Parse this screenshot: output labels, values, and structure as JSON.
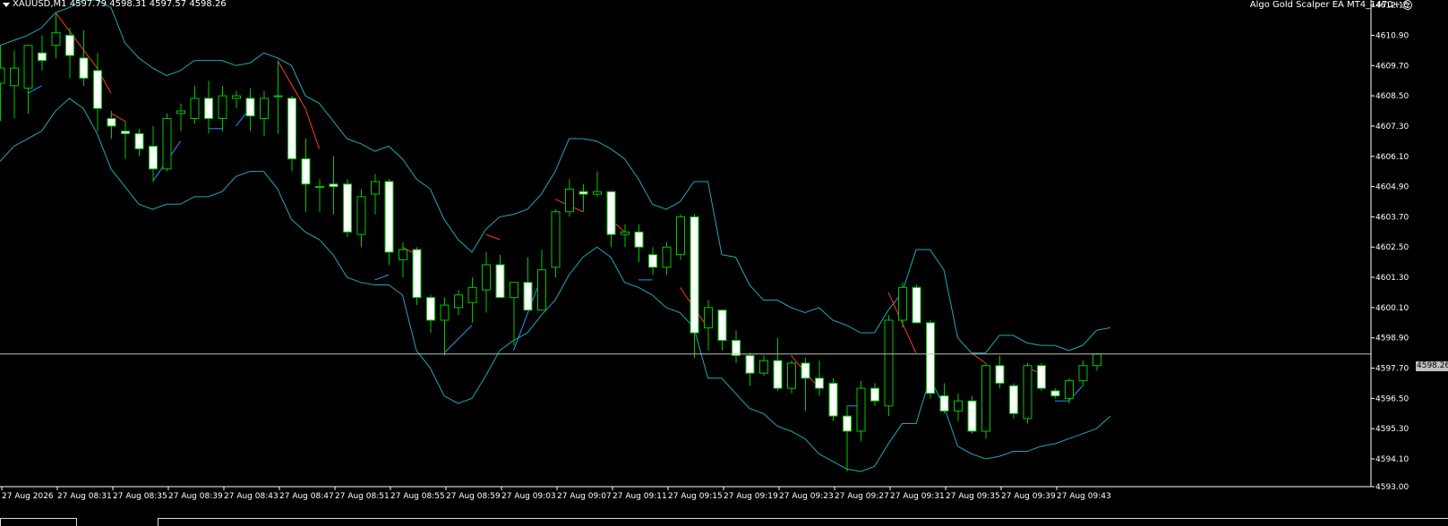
{
  "header": {
    "symbol_title": "XAUUSD,M1  4597.79 4598.31 4597.57 4598.26",
    "ea_label": "Algo Gold Scalper EA MT4_1470+",
    "smiley": "☺"
  },
  "current_price_label": "4598.26",
  "colors": {
    "background": "#000000",
    "bull_candle": "#00c800",
    "bear_candle_body": "#ffffff",
    "bands": "#1fa8b8",
    "signal_up": "#2196f3",
    "signal_down": "#ff3b1f",
    "axis": "#ffffff",
    "price_line": "#bfbfbf"
  },
  "chart_data": {
    "type": "candlestick",
    "symbol": "XAUUSD",
    "timeframe": "M1",
    "ylim": [
      4593.0,
      4612.3
    ],
    "y_ticks": [
      "4612.10",
      "4610.90",
      "4609.70",
      "4608.50",
      "4607.30",
      "4606.10",
      "4604.90",
      "4603.70",
      "4602.50",
      "4601.30",
      "4600.10",
      "4598.90",
      "4597.70",
      "4596.50",
      "4595.30",
      "4594.10",
      "4593.00"
    ],
    "x_labels": [
      "27 Aug 2026",
      "27 Aug 08:31",
      "27 Aug 08:35",
      "27 Aug 08:39",
      "27 Aug 08:43",
      "27 Aug 08:47",
      "27 Aug 08:51",
      "27 Aug 08:55",
      "27 Aug 08:59",
      "27 Aug 09:03",
      "27 Aug 09:07",
      "27 Aug 09:11",
      "27 Aug 09:15",
      "27 Aug 09:19",
      "27 Aug 09:23",
      "27 Aug 09:27",
      "27 Aug 09:31",
      "27 Aug 09:35",
      "27 Aug 09:39",
      "27 Aug 09:43"
    ],
    "current_price": 4598.26,
    "candles": [
      {
        "o": 4609.0,
        "h": 4610.5,
        "l": 4607.5,
        "c": 4609.6
      },
      {
        "o": 4608.9,
        "h": 4610.3,
        "l": 4607.6,
        "c": 4609.6
      },
      {
        "o": 4608.8,
        "h": 4610.5,
        "l": 4607.8,
        "c": 4610.5
      },
      {
        "o": 4610.2,
        "h": 4610.9,
        "l": 4609.5,
        "c": 4609.9
      },
      {
        "o": 4610.5,
        "h": 4611.8,
        "l": 4610.0,
        "c": 4611.0
      },
      {
        "o": 4610.9,
        "h": 4611.2,
        "l": 4609.2,
        "c": 4610.1
      },
      {
        "o": 4610.0,
        "h": 4611.1,
        "l": 4608.9,
        "c": 4609.2
      },
      {
        "o": 4609.5,
        "h": 4610.2,
        "l": 4607.1,
        "c": 4608.0
      },
      {
        "o": 4607.6,
        "h": 4607.9,
        "l": 4606.8,
        "c": 4607.3
      },
      {
        "o": 4607.1,
        "h": 4607.5,
        "l": 4606.0,
        "c": 4607.0
      },
      {
        "o": 4607.0,
        "h": 4607.2,
        "l": 4606.1,
        "c": 4606.4
      },
      {
        "o": 4606.5,
        "h": 4607.3,
        "l": 4605.1,
        "c": 4605.6
      },
      {
        "o": 4605.6,
        "h": 4607.8,
        "l": 4605.5,
        "c": 4607.6
      },
      {
        "o": 4607.8,
        "h": 4608.2,
        "l": 4607.1,
        "c": 4607.9
      },
      {
        "o": 4607.6,
        "h": 4608.9,
        "l": 4607.4,
        "c": 4608.4
      },
      {
        "o": 4608.4,
        "h": 4609.1,
        "l": 4607.0,
        "c": 4607.6
      },
      {
        "o": 4607.6,
        "h": 4608.9,
        "l": 4607.1,
        "c": 4608.5
      },
      {
        "o": 4608.4,
        "h": 4608.7,
        "l": 4608.0,
        "c": 4608.5
      },
      {
        "o": 4608.4,
        "h": 4608.8,
        "l": 4607.1,
        "c": 4607.7
      },
      {
        "o": 4607.6,
        "h": 4608.7,
        "l": 4606.9,
        "c": 4608.4
      },
      {
        "o": 4608.5,
        "h": 4609.9,
        "l": 4607.0,
        "c": 4608.5
      },
      {
        "o": 4608.4,
        "h": 4608.5,
        "l": 4605.5,
        "c": 4606.0
      },
      {
        "o": 4606.0,
        "h": 4606.8,
        "l": 4603.9,
        "c": 4605.0
      },
      {
        "o": 4604.9,
        "h": 4605.2,
        "l": 4603.9,
        "c": 4604.9
      },
      {
        "o": 4605.0,
        "h": 4606.1,
        "l": 4603.8,
        "c": 4604.9
      },
      {
        "o": 4605.0,
        "h": 4605.2,
        "l": 4602.9,
        "c": 4603.1
      },
      {
        "o": 4603.0,
        "h": 4604.8,
        "l": 4602.5,
        "c": 4604.5
      },
      {
        "o": 4604.6,
        "h": 4605.4,
        "l": 4603.8,
        "c": 4605.1
      },
      {
        "o": 4605.1,
        "h": 4605.2,
        "l": 4601.8,
        "c": 4602.3
      },
      {
        "o": 4602.0,
        "h": 4602.7,
        "l": 4601.3,
        "c": 4602.4
      },
      {
        "o": 4602.4,
        "h": 4602.5,
        "l": 4600.2,
        "c": 4600.5
      },
      {
        "o": 4600.5,
        "h": 4600.6,
        "l": 4599.1,
        "c": 4599.6
      },
      {
        "o": 4599.6,
        "h": 4600.5,
        "l": 4598.2,
        "c": 4600.2
      },
      {
        "o": 4600.1,
        "h": 4600.8,
        "l": 4599.8,
        "c": 4600.6
      },
      {
        "o": 4600.3,
        "h": 4601.3,
        "l": 4599.5,
        "c": 4600.9
      },
      {
        "o": 4600.8,
        "h": 4602.3,
        "l": 4599.9,
        "c": 4601.8
      },
      {
        "o": 4601.8,
        "h": 4602.2,
        "l": 4600.6,
        "c": 4600.5
      },
      {
        "o": 4600.5,
        "h": 4600.6,
        "l": 4598.6,
        "c": 4601.1
      },
      {
        "o": 4601.1,
        "h": 4602.1,
        "l": 4600.0,
        "c": 4600.0
      },
      {
        "o": 4600.0,
        "h": 4602.4,
        "l": 4600.0,
        "c": 4601.6
      },
      {
        "o": 4601.7,
        "h": 4604.0,
        "l": 4601.3,
        "c": 4603.9
      },
      {
        "o": 4603.9,
        "h": 4605.2,
        "l": 4603.7,
        "c": 4604.8
      },
      {
        "o": 4604.7,
        "h": 4605.0,
        "l": 4603.9,
        "c": 4604.6
      },
      {
        "o": 4604.6,
        "h": 4605.5,
        "l": 4604.5,
        "c": 4604.7
      },
      {
        "o": 4604.7,
        "h": 4604.7,
        "l": 4602.5,
        "c": 4603.0
      },
      {
        "o": 4603.0,
        "h": 4603.4,
        "l": 4602.5,
        "c": 4603.1
      },
      {
        "o": 4603.1,
        "h": 4603.4,
        "l": 4601.9,
        "c": 4602.5
      },
      {
        "o": 4602.2,
        "h": 4602.5,
        "l": 4601.4,
        "c": 4601.7
      },
      {
        "o": 4601.7,
        "h": 4602.7,
        "l": 4601.4,
        "c": 4602.5
      },
      {
        "o": 4602.2,
        "h": 4603.8,
        "l": 4602.0,
        "c": 4603.7
      },
      {
        "o": 4603.7,
        "h": 4603.8,
        "l": 4598.1,
        "c": 4599.1
      },
      {
        "o": 4599.3,
        "h": 4600.4,
        "l": 4598.4,
        "c": 4600.1
      },
      {
        "o": 4600.0,
        "h": 4600.0,
        "l": 4598.4,
        "c": 4598.8
      },
      {
        "o": 4598.8,
        "h": 4599.2,
        "l": 4597.9,
        "c": 4598.2
      },
      {
        "o": 4598.2,
        "h": 4598.3,
        "l": 4597.0,
        "c": 4597.5
      },
      {
        "o": 4597.5,
        "h": 4598.2,
        "l": 4597.4,
        "c": 4598.0
      },
      {
        "o": 4598.0,
        "h": 4598.9,
        "l": 4596.8,
        "c": 4596.9
      },
      {
        "o": 4596.9,
        "h": 4598.0,
        "l": 4596.7,
        "c": 4597.9
      },
      {
        "o": 4597.9,
        "h": 4598.1,
        "l": 4596.0,
        "c": 4597.3
      },
      {
        "o": 4597.3,
        "h": 4598.0,
        "l": 4596.6,
        "c": 4596.9
      },
      {
        "o": 4597.1,
        "h": 4597.3,
        "l": 4595.6,
        "c": 4595.8
      },
      {
        "o": 4595.8,
        "h": 4596.2,
        "l": 4593.6,
        "c": 4595.2
      },
      {
        "o": 4595.2,
        "h": 4597.2,
        "l": 4594.8,
        "c": 4596.9
      },
      {
        "o": 4596.9,
        "h": 4597.1,
        "l": 4596.2,
        "c": 4596.4
      },
      {
        "o": 4596.2,
        "h": 4599.8,
        "l": 4595.8,
        "c": 4599.6
      },
      {
        "o": 4599.6,
        "h": 4601.1,
        "l": 4599.3,
        "c": 4600.9
      },
      {
        "o": 4600.9,
        "h": 4601.0,
        "l": 4599.5,
        "c": 4599.5
      },
      {
        "o": 4599.5,
        "h": 4599.6,
        "l": 4596.5,
        "c": 4596.7
      },
      {
        "o": 4596.6,
        "h": 4597.1,
        "l": 4595.9,
        "c": 4596.0
      },
      {
        "o": 4596.0,
        "h": 4596.7,
        "l": 4595.6,
        "c": 4596.4
      },
      {
        "o": 4596.4,
        "h": 4596.6,
        "l": 4595.1,
        "c": 4595.2
      },
      {
        "o": 4595.2,
        "h": 4597.9,
        "l": 4594.9,
        "c": 4597.8
      },
      {
        "o": 4597.8,
        "h": 4598.2,
        "l": 4596.9,
        "c": 4597.1
      },
      {
        "o": 4597.0,
        "h": 4597.1,
        "l": 4595.7,
        "c": 4595.9
      },
      {
        "o": 4595.7,
        "h": 4597.9,
        "l": 4595.5,
        "c": 4597.8
      },
      {
        "o": 4597.8,
        "h": 4597.9,
        "l": 4596.8,
        "c": 4596.9
      },
      {
        "o": 4596.8,
        "h": 4596.9,
        "l": 4596.5,
        "c": 4596.6
      },
      {
        "o": 4596.5,
        "h": 4597.3,
        "l": 4596.3,
        "c": 4597.2
      },
      {
        "o": 4597.2,
        "h": 4598.0,
        "l": 4597.0,
        "c": 4597.8
      },
      {
        "o": 4597.8,
        "h": 4598.3,
        "l": 4597.6,
        "c": 4598.26
      }
    ],
    "indicators": {
      "envelope_upper": [
        4610.5,
        4610.7,
        4610.9,
        4611.2,
        4611.8,
        4612.0,
        4612.3,
        4612.3,
        4612.0,
        4610.6,
        4610.0,
        4609.6,
        4609.3,
        4609.5,
        4609.9,
        4609.9,
        4609.9,
        4609.7,
        4609.8,
        4610.2,
        4610.0,
        4609.7,
        4608.5,
        4608.2,
        4607.5,
        4606.8,
        4606.6,
        4606.3,
        4606.5,
        4606.0,
        4605.2,
        4604.8,
        4603.6,
        4602.8,
        4602.3,
        4603.2,
        4603.7,
        4603.8,
        4604.0,
        4604.6,
        4605.5,
        4606.8,
        4606.8,
        4606.7,
        4606.4,
        4606.0,
        4605.2,
        4604.2,
        4604.0,
        4604.3,
        4605.1,
        4605.1,
        4602.2,
        4602.1,
        4601.0,
        4600.4,
        4600.4,
        4600.1,
        4599.9,
        4600.1,
        4599.6,
        4599.4,
        4599.1,
        4599.1,
        4600.0,
        4600.7,
        4602.4,
        4602.4,
        4601.6,
        4598.9,
        4598.3,
        4598.3,
        4599.0,
        4599.0,
        4598.7,
        4598.6,
        4598.6,
        4598.4,
        4598.6,
        4599.2,
        4599.3
      ],
      "envelope_lower": [
        4605.9,
        4606.5,
        4606.8,
        4607.1,
        4607.9,
        4608.4,
        4608.0,
        4607.0,
        4605.6,
        4604.9,
        4604.2,
        4604.0,
        4604.2,
        4604.2,
        4604.5,
        4604.5,
        4604.7,
        4605.3,
        4605.5,
        4605.5,
        4604.8,
        4603.6,
        4603.1,
        4602.8,
        4602.2,
        4601.3,
        4601.1,
        4601.0,
        4601.0,
        4600.6,
        4598.4,
        4597.7,
        4596.6,
        4596.3,
        4596.5,
        4597.4,
        4598.4,
        4598.8,
        4599.1,
        4599.8,
        4600.4,
        4601.4,
        4602.1,
        4602.5,
        4602.1,
        4601.1,
        4600.9,
        4600.6,
        4600.1,
        4599.9,
        4599.3,
        4597.3,
        4597.3,
        4596.7,
        4596.1,
        4595.9,
        4595.4,
        4595.2,
        4594.9,
        4594.3,
        4594.0,
        4593.7,
        4593.6,
        4593.8,
        4594.7,
        4595.5,
        4595.5,
        4597.3,
        4596.2,
        4594.6,
        4594.3,
        4594.1,
        4594.2,
        4594.4,
        4594.4,
        4594.6,
        4594.7,
        4594.9,
        4595.1,
        4595.3,
        4595.8
      ],
      "signal_segments": [
        {
          "color": "down",
          "points": [
            [
              4,
              4611.8
            ],
            [
              7,
              4609.6
            ]
          ]
        },
        {
          "color": "down",
          "points": [
            [
              7,
              4609.6
            ],
            [
              8,
              4608.6
            ]
          ]
        },
        {
          "color": "down",
          "points": [
            [
              8,
              4607.8
            ],
            [
              9,
              4607.5
            ]
          ]
        },
        {
          "color": "up",
          "points": [
            [
              2,
              4608.6
            ],
            [
              3,
              4608.9
            ]
          ]
        },
        {
          "color": "up",
          "points": [
            [
              11,
              4605.1
            ],
            [
              13,
              4606.7
            ]
          ]
        },
        {
          "color": "up",
          "points": [
            [
              15,
              4607.2
            ],
            [
              16,
              4607.2
            ]
          ]
        },
        {
          "color": "up",
          "points": [
            [
              17,
              4607.3
            ],
            [
              18,
              4608.0
            ]
          ]
        },
        {
          "color": "down",
          "points": [
            [
              20,
              4609.9
            ],
            [
              22,
              4608.0
            ],
            [
              23,
              4606.4
            ]
          ]
        },
        {
          "color": "up",
          "points": [
            [
              27,
              4601.2
            ],
            [
              28,
              4601.4
            ]
          ]
        },
        {
          "color": "down",
          "points": [
            [
              29,
              4602.5
            ],
            [
              30,
              4602.2
            ]
          ]
        },
        {
          "color": "up",
          "points": [
            [
              32,
              4598.3
            ],
            [
              34,
              4599.4
            ]
          ]
        },
        {
          "color": "down",
          "points": [
            [
              35,
              4603.0
            ],
            [
              36,
              4602.8
            ]
          ]
        },
        {
          "color": "up",
          "points": [
            [
              37,
              4598.4
            ],
            [
              39,
              4601.3
            ]
          ]
        },
        {
          "color": "down",
          "points": [
            [
              40,
              4604.4
            ],
            [
              42,
              4603.9
            ]
          ]
        },
        {
          "color": "down",
          "points": [
            [
              44,
              4603.6
            ],
            [
              45,
              4603.1
            ]
          ]
        },
        {
          "color": "up",
          "points": [
            [
              46,
              4601.2
            ],
            [
              47,
              4601.2
            ]
          ]
        },
        {
          "color": "down",
          "points": [
            [
              49,
              4600.9
            ],
            [
              51,
              4599.3
            ]
          ]
        },
        {
          "color": "up",
          "points": [
            [
              61,
              4596.2
            ],
            [
              62,
              4596.2
            ]
          ]
        },
        {
          "color": "down",
          "points": [
            [
              57,
              4598.2
            ],
            [
              59,
              4596.9
            ]
          ]
        },
        {
          "color": "down",
          "points": [
            [
              64,
              4600.7
            ],
            [
              66,
              4598.3
            ]
          ]
        },
        {
          "color": "down",
          "points": [
            [
              70,
              4598.3
            ],
            [
              71,
              4597.9
            ]
          ]
        },
        {
          "color": "down",
          "points": [
            [
              74,
              4597.7
            ],
            [
              75,
              4597.5
            ]
          ]
        },
        {
          "color": "up",
          "points": [
            [
              76,
              4596.4
            ],
            [
              77,
              4596.4
            ]
          ]
        },
        {
          "color": "up",
          "points": [
            [
              77,
              4596.4
            ],
            [
              78,
              4597.0
            ]
          ]
        }
      ]
    }
  }
}
